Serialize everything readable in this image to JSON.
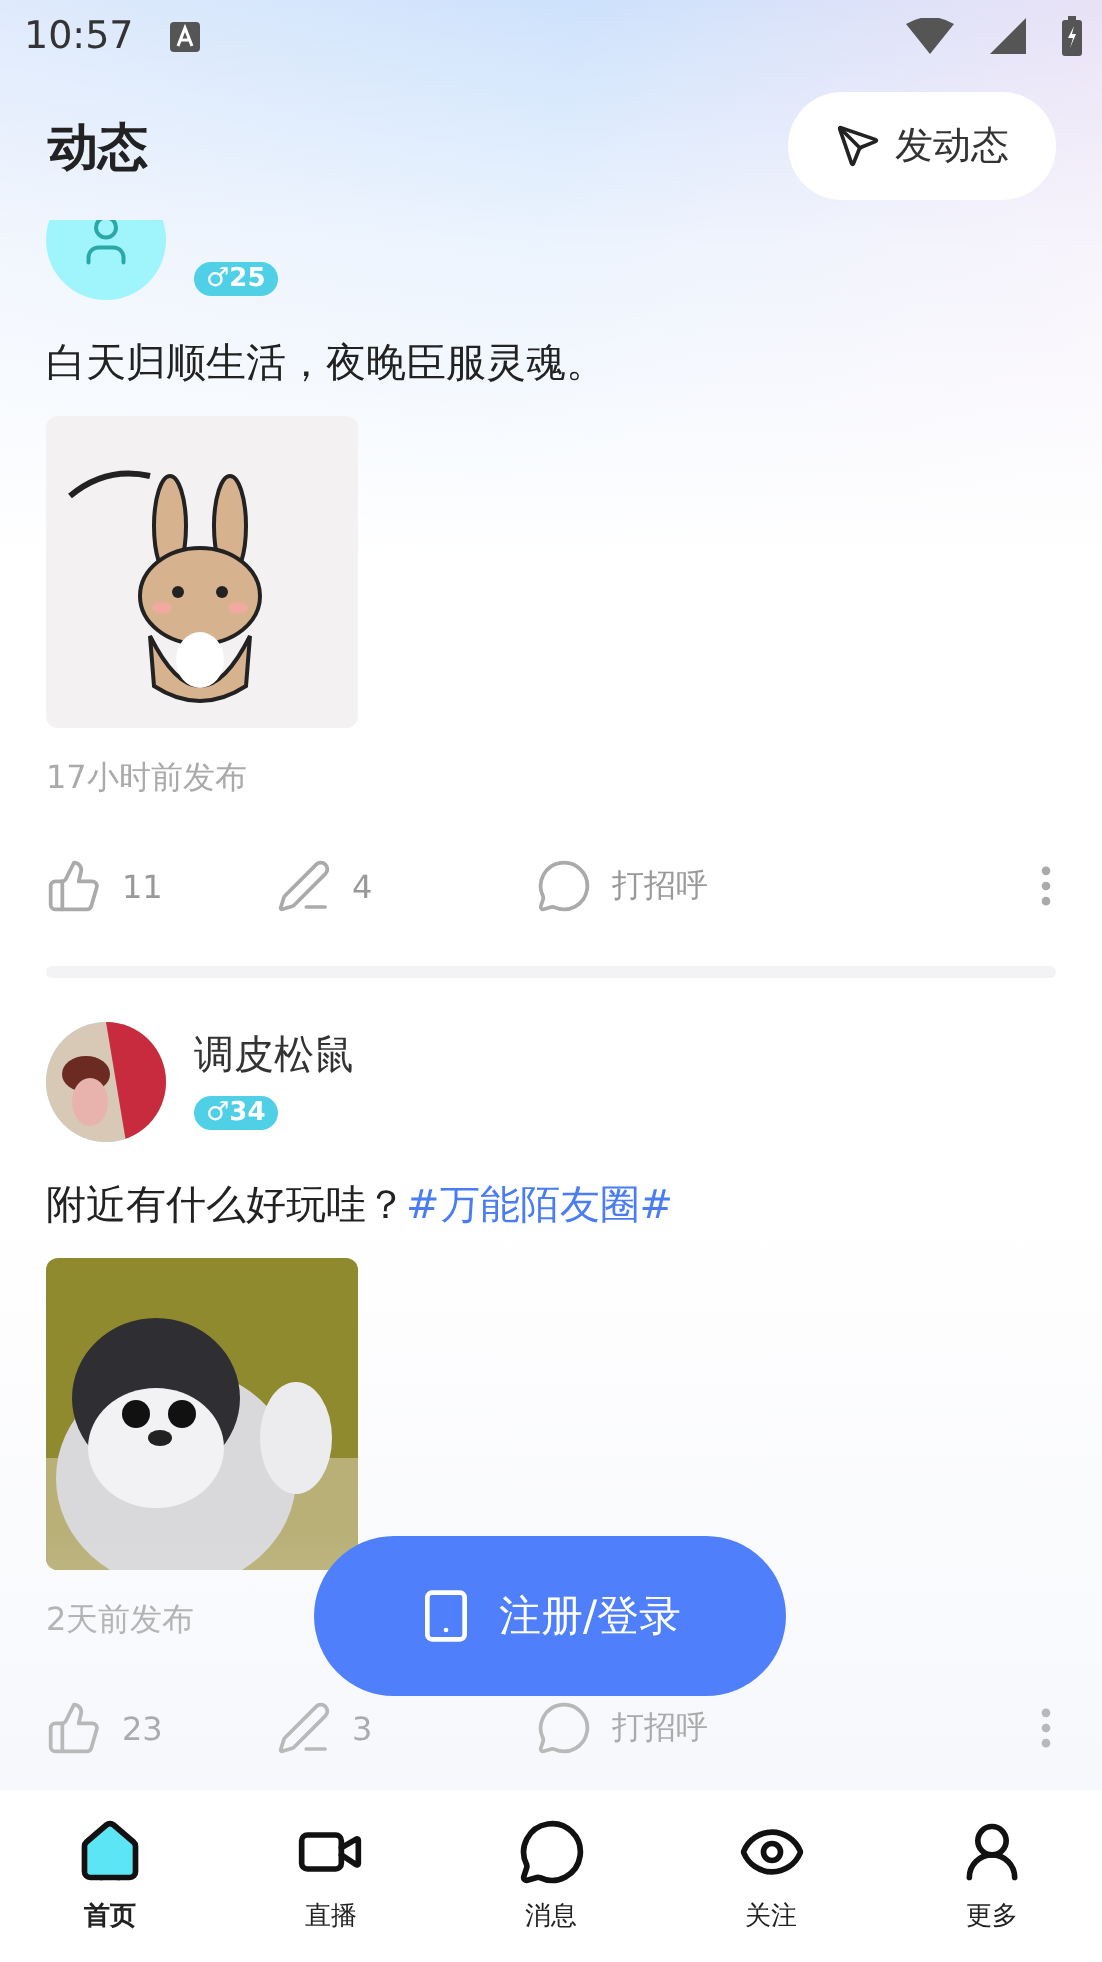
{
  "status_bar": {
    "time": "10:57"
  },
  "header": {
    "title": "动态",
    "post_button": "发动态"
  },
  "posts": [
    {
      "badge": "♂25",
      "text": "白天归顺生活，夜晚臣服灵魂。",
      "time": "17小时前发布",
      "likes": "11",
      "comments": "4",
      "greet": "打招呼"
    },
    {
      "name": "调皮松鼠",
      "badge": "♂34",
      "text": "附近有什么好玩哇？",
      "hashtag": "#万能陌友圈#",
      "time": "2天前发布",
      "likes": "23",
      "comments": "3",
      "greet": "打招呼"
    }
  ],
  "login_button": "注册/登录",
  "nav": [
    {
      "kind": "home",
      "label": "首页",
      "selected": true
    },
    {
      "kind": "live",
      "label": "直播",
      "selected": false
    },
    {
      "kind": "message",
      "label": "消息",
      "selected": false
    },
    {
      "kind": "follow",
      "label": "关注",
      "selected": false
    },
    {
      "kind": "more",
      "label": "更多",
      "selected": false
    }
  ]
}
